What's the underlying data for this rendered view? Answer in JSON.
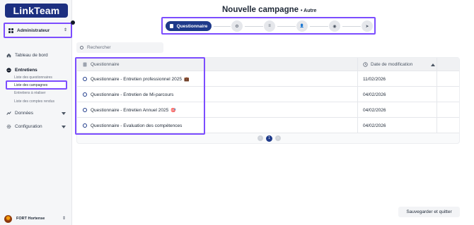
{
  "app": {
    "logo": "LinkTeam"
  },
  "sidebar": {
    "role": "Administrateur",
    "nav": {
      "tableau": "Tableau de bord",
      "entretiens": "Entretiens",
      "entretiens_items": [
        "Liste des questionnaires",
        "Liste des campagnes",
        "Entretiens à réaliser",
        "Liste des comptes rendus"
      ],
      "donnees": "Données",
      "configuration": "Configuration"
    },
    "user": {
      "name": "FORT Hortense"
    }
  },
  "header": {
    "title": "Nouvelle campagne",
    "subtitle": "• Autre"
  },
  "stepper": {
    "active_label": "Questionnaire",
    "step_icons": [
      "gear-icon",
      "list-icon",
      "person-icon",
      "eye-icon",
      "send-icon"
    ],
    "step_glyphs": [
      "⚙",
      "≡",
      "👤",
      "◉",
      "➤"
    ]
  },
  "search": {
    "placeholder": "Rechercher"
  },
  "table": {
    "col_questionnaire": "Questionnaire",
    "col_date": "Date de modification",
    "rows": [
      {
        "name": "Questionnaire - Entretien professionnel 2025",
        "emoji": "💼",
        "date": "11/02/2026"
      },
      {
        "name": "Questionnaire - Entretien de Mi-parcours",
        "emoji": "",
        "date": "04/02/2026"
      },
      {
        "name": "Questionnaire - Entretien Annuel 2025",
        "emoji": "🎯",
        "date": "04/02/2026"
      },
      {
        "name": "Questionnaire - Evaluation des compétences",
        "emoji": "",
        "date": "04/02/2026"
      }
    ]
  },
  "pagination": {
    "current": "1"
  },
  "footer": {
    "save_label": "Sauvegarder et quitter"
  },
  "colors": {
    "brand": "#1c2f80",
    "accent_outline": "#7c4dff",
    "active_step": "#1e3a8a"
  }
}
